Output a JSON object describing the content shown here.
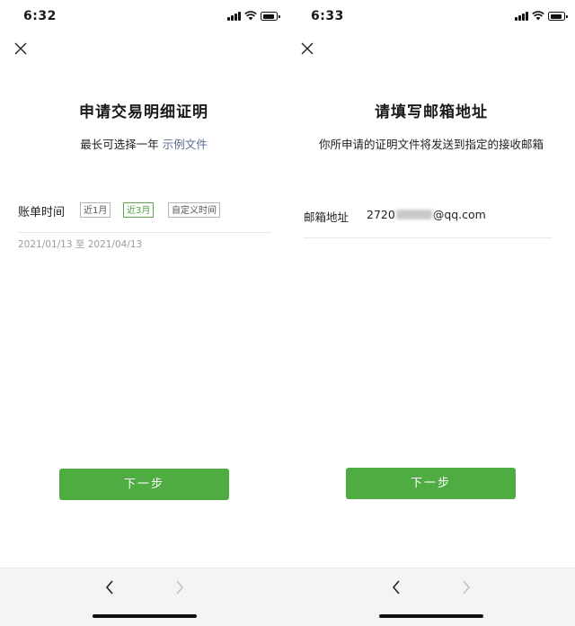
{
  "left": {
    "time": "6:32",
    "title": "申请交易明细证明",
    "subtitle_text": "最长可选择一年",
    "subtitle_link": "示例文件",
    "bill_label": "账单时间",
    "chips": [
      "近1月",
      "近3月",
      "自定义时间"
    ],
    "selected_chip": "近3月",
    "date_range": "2021/01/13 至 2021/04/13",
    "next_button": "下一步"
  },
  "right": {
    "time": "6:33",
    "title": "请填写邮箱地址",
    "subtitle": "你所申请的证明文件将发送到指定的接收邮箱",
    "email_label": "邮箱地址",
    "email_prefix": "2720",
    "email_suffix": "@qq.com",
    "next_button": "下一步"
  },
  "colors": {
    "accent_green": "#4fac43",
    "link_blue": "#576b95"
  },
  "icons": [
    "close-icon",
    "signal-icon",
    "wifi-icon",
    "battery-icon",
    "back-icon",
    "forward-icon"
  ]
}
